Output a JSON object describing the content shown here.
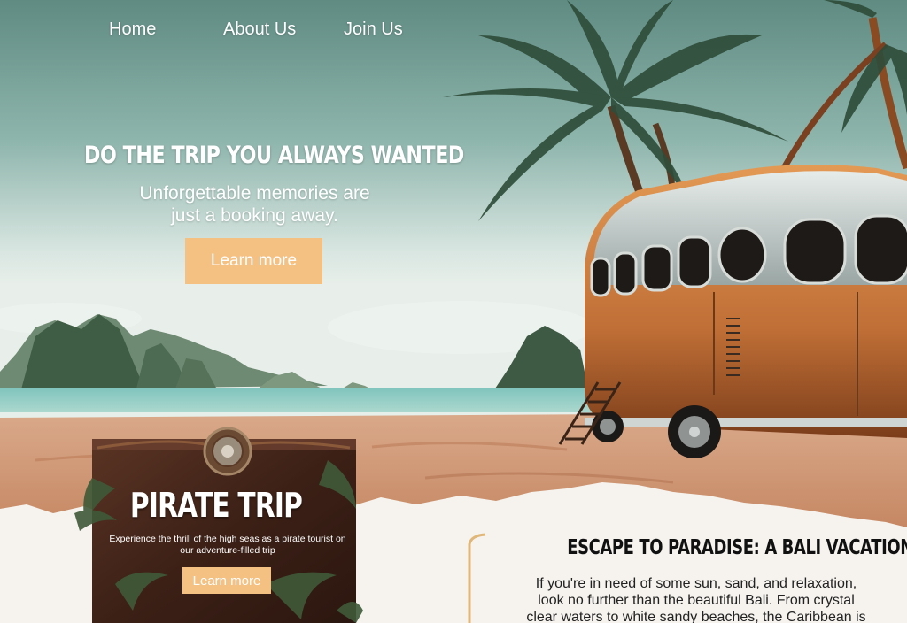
{
  "nav": {
    "items": [
      {
        "label": "Home"
      },
      {
        "label": "About Us"
      },
      {
        "label": "Join Us"
      }
    ]
  },
  "hero": {
    "title": "DO THE TRIP YOU ALWAYS WANTED",
    "subtitle_line1": "Unforgettable memories are",
    "subtitle_line2": "just a booking away.",
    "button_label": "Learn more"
  },
  "pirate_card": {
    "title": "PIRATE TRIP",
    "description": "Experience the thrill of the high seas as a pirate tourist on our adventure-filled trip",
    "button_label": "Learn more"
  },
  "article": {
    "title": "ESCAPE TO PARADISE: A BALI VACATION",
    "body": "If you're in need of some sun, sand, and relaxation, look no further than the beautiful Bali. From crystal clear waters to white sandy beaches, the Caribbean is"
  },
  "colors": {
    "accent": "#f5c183",
    "sky_top": "#6f9a8f",
    "sand": "#c88e68",
    "paper": "#f6f3ee",
    "bus_body": "#c77a3c"
  }
}
